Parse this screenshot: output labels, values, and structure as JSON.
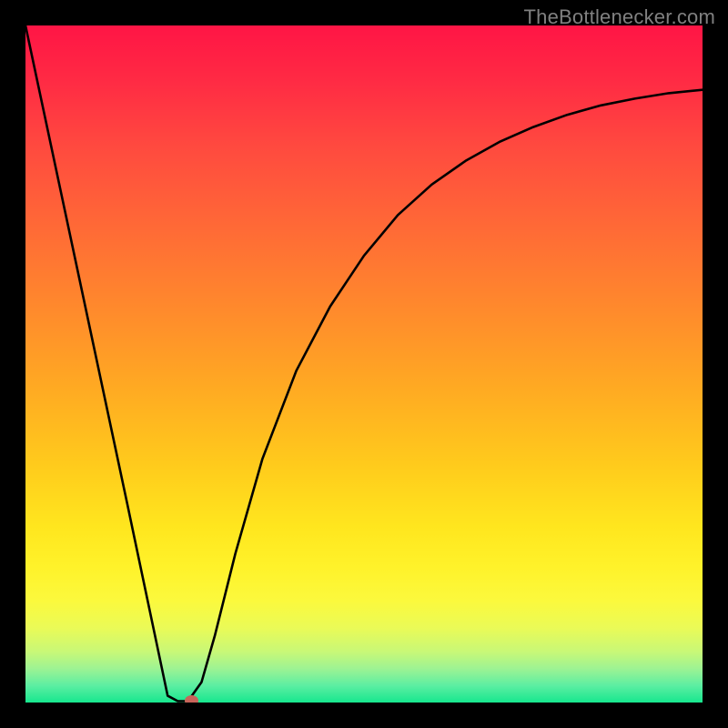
{
  "watermark": "TheBottlenecker.com",
  "chart_data": {
    "type": "line",
    "title": "",
    "xlabel": "",
    "ylabel": "",
    "xlim": [
      0,
      100
    ],
    "ylim": [
      0,
      100
    ],
    "curve_points": [
      {
        "x": 0.0,
        "y": 100.0
      },
      {
        "x": 5.0,
        "y": 76.5
      },
      {
        "x": 10.0,
        "y": 53.0
      },
      {
        "x": 15.0,
        "y": 29.5
      },
      {
        "x": 19.0,
        "y": 10.5
      },
      {
        "x": 21.0,
        "y": 1.0
      },
      {
        "x": 22.5,
        "y": 0.2
      },
      {
        "x": 24.0,
        "y": 0.2
      },
      {
        "x": 26.0,
        "y": 3.0
      },
      {
        "x": 28.0,
        "y": 10.0
      },
      {
        "x": 31.0,
        "y": 22.0
      },
      {
        "x": 35.0,
        "y": 36.0
      },
      {
        "x": 40.0,
        "y": 49.0
      },
      {
        "x": 45.0,
        "y": 58.5
      },
      {
        "x": 50.0,
        "y": 66.0
      },
      {
        "x": 55.0,
        "y": 72.0
      },
      {
        "x": 60.0,
        "y": 76.5
      },
      {
        "x": 65.0,
        "y": 80.0
      },
      {
        "x": 70.0,
        "y": 82.8
      },
      {
        "x": 75.0,
        "y": 85.0
      },
      {
        "x": 80.0,
        "y": 86.8
      },
      {
        "x": 85.0,
        "y": 88.2
      },
      {
        "x": 90.0,
        "y": 89.2
      },
      {
        "x": 95.0,
        "y": 90.0
      },
      {
        "x": 100.0,
        "y": 90.5
      }
    ],
    "marker": {
      "x": 24.5,
      "y": 0.3
    },
    "gradient_stops": [
      {
        "pos": 0,
        "color": "#ff1545"
      },
      {
        "pos": 8,
        "color": "#ff2a44"
      },
      {
        "pos": 18,
        "color": "#ff4a3f"
      },
      {
        "pos": 30,
        "color": "#ff6a36"
      },
      {
        "pos": 42,
        "color": "#ff8a2c"
      },
      {
        "pos": 54,
        "color": "#ffab22"
      },
      {
        "pos": 65,
        "color": "#ffcb1c"
      },
      {
        "pos": 74,
        "color": "#ffe61e"
      },
      {
        "pos": 80,
        "color": "#fff22a"
      },
      {
        "pos": 85,
        "color": "#fbf93d"
      },
      {
        "pos": 89,
        "color": "#eafa57"
      },
      {
        "pos": 92.5,
        "color": "#c8f877"
      },
      {
        "pos": 95,
        "color": "#9df393"
      },
      {
        "pos": 97.5,
        "color": "#5ceea2"
      },
      {
        "pos": 100,
        "color": "#17e78e"
      }
    ],
    "curve_color": "#000000",
    "marker_color": "#c8645a",
    "background_color": "#000000"
  }
}
